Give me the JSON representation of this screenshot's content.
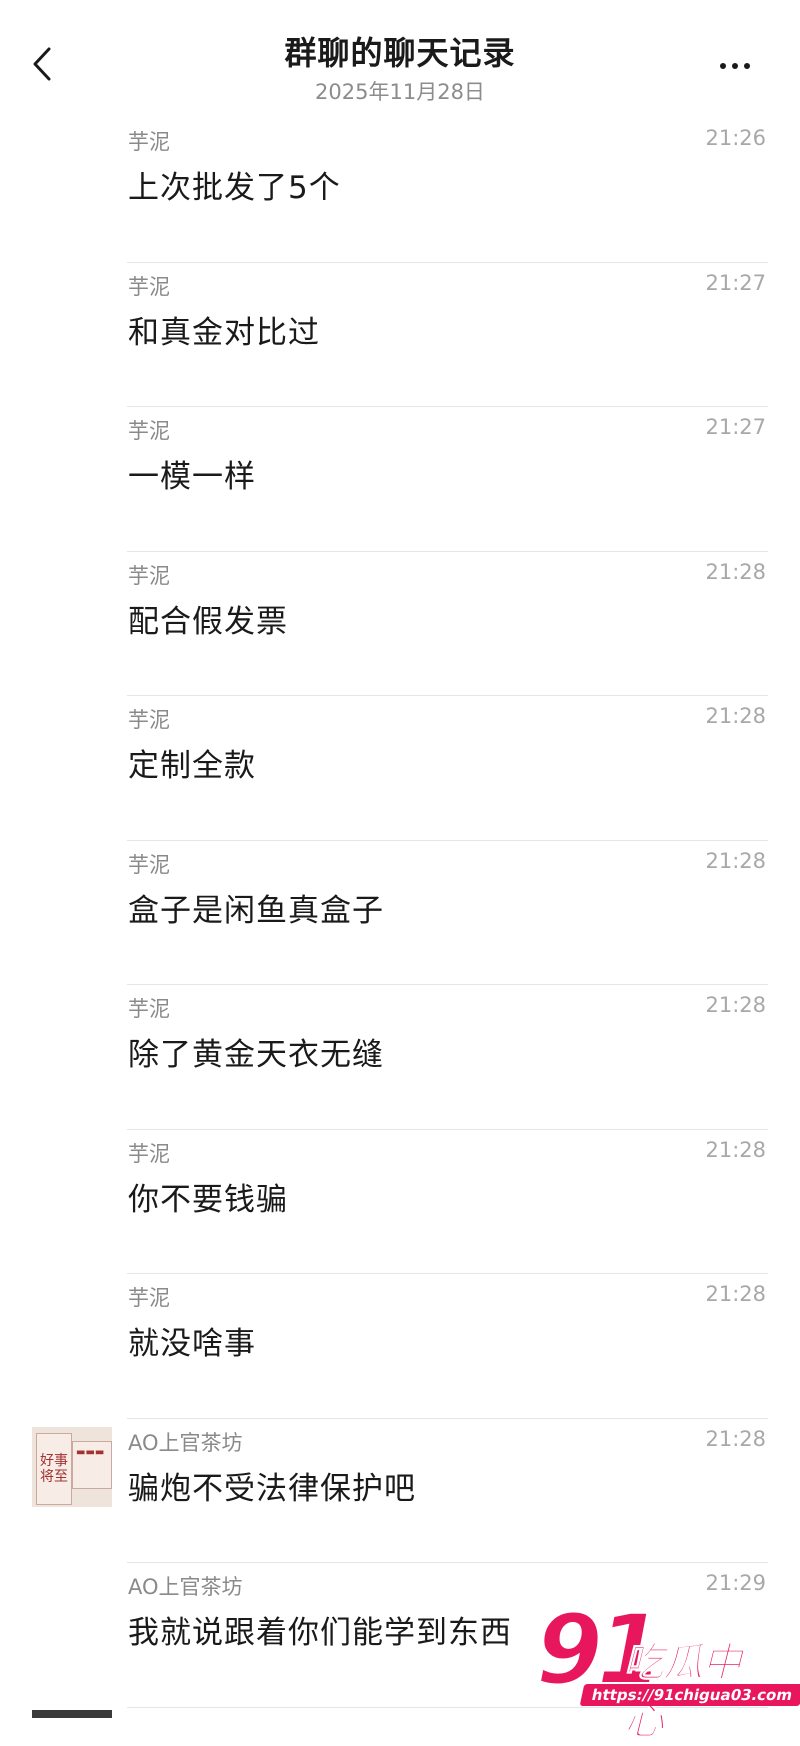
{
  "header": {
    "title": "群聊的聊天记录",
    "date": "2025年11月28日"
  },
  "messages": [
    {
      "sender": "芋泥",
      "time": "21:26",
      "text": "上次批发了5个"
    },
    {
      "sender": "芋泥",
      "time": "21:27",
      "text": "和真金对比过"
    },
    {
      "sender": "芋泥",
      "time": "21:27",
      "text": "一模一样"
    },
    {
      "sender": "芋泥",
      "time": "21:28",
      "text": "配合假发票"
    },
    {
      "sender": "芋泥",
      "time": "21:28",
      "text": "定制全款"
    },
    {
      "sender": "芋泥",
      "time": "21:28",
      "text": "盒子是闲鱼真盒子"
    },
    {
      "sender": "芋泥",
      "time": "21:28",
      "text": "除了黄金天衣无缝"
    },
    {
      "sender": "芋泥",
      "time": "21:28",
      "text": "你不要钱骗"
    },
    {
      "sender": "芋泥",
      "time": "21:28",
      "text": "就没啥事"
    },
    {
      "sender": "AO上官茶坊",
      "time": "21:28",
      "text": "骗炮不受法律保护吧"
    },
    {
      "sender": "AO上官茶坊",
      "time": "21:29",
      "text": "我就说跟着你们能学到东西"
    }
  ],
  "watermark": {
    "number": "91",
    "name": "吃瓜中心",
    "url": "https://91chigua03.com"
  },
  "colors": {
    "watermark": "#e8175d",
    "divider": "#e6e6e6",
    "secondary_text": "#8a8a8a"
  },
  "icons": {
    "back": "chevron-left-icon",
    "more": "more-dots-icon"
  }
}
